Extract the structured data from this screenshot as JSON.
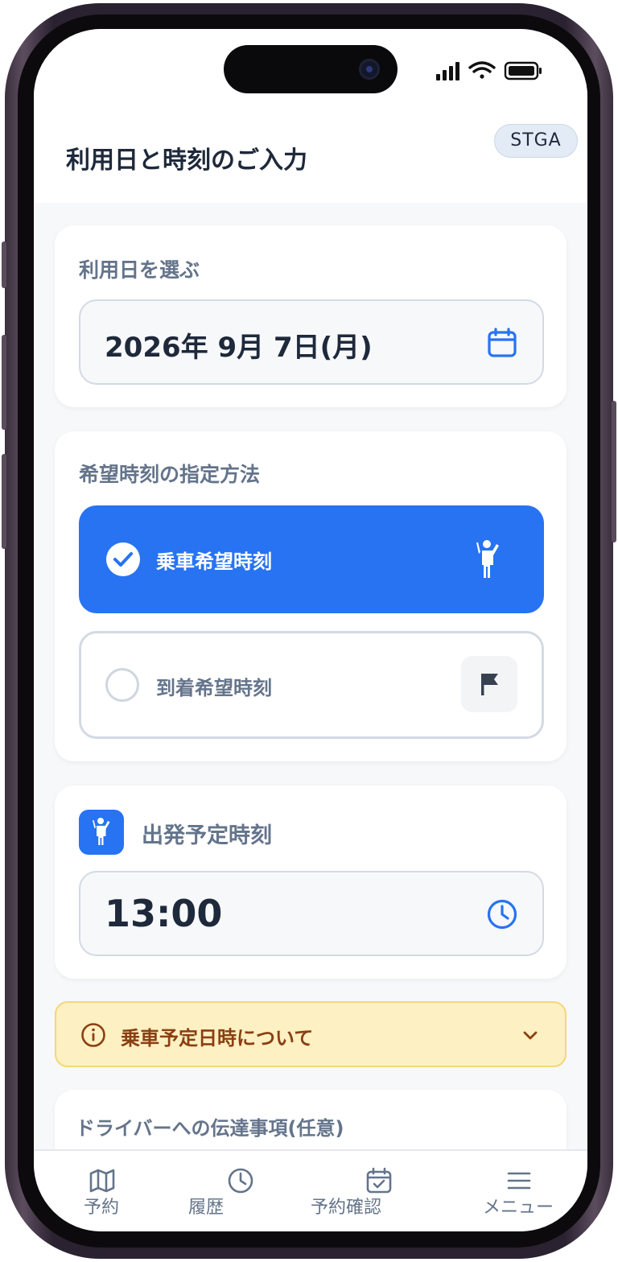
{
  "header": {
    "title": "利用日と時刻のご入力",
    "env_badge": "STGA"
  },
  "date_card": {
    "title": "利用日を選ぶ",
    "value": "2026年 9月 7日(月)",
    "icon": "calendar-icon"
  },
  "time_method": {
    "title": "希望時刻の指定方法",
    "options": [
      {
        "label": "乗車希望時刻",
        "selected": true,
        "icon": "person-waving-icon"
      },
      {
        "label": "到着希望時刻",
        "selected": false,
        "icon": "flag-icon"
      }
    ]
  },
  "departure": {
    "title": "出発予定時刻",
    "value": "13:00",
    "icon": "clock-icon"
  },
  "notice": {
    "text": "乗車予定日時について",
    "icon": "info-icon"
  },
  "driver_note": {
    "title": "ドライバーへの伝達事項(任意)"
  },
  "tabbar": {
    "items": [
      {
        "label": "予約",
        "icon": "map-icon"
      },
      {
        "label": "履歴",
        "icon": "clock-icon"
      },
      {
        "label": "予約確認",
        "icon": "calendar-check-icon"
      },
      {
        "label": "メニュー",
        "icon": "menu-icon"
      }
    ]
  },
  "colors": {
    "primary": "#2773f2",
    "notice_bg": "#fdf0c2",
    "notice_text": "#8a3f12",
    "title_text": "#1e293b",
    "muted_text": "#64748b"
  }
}
